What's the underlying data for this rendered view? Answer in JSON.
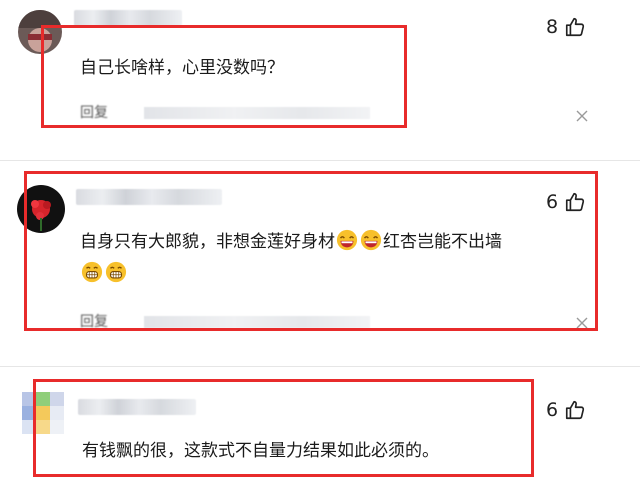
{
  "comments": [
    {
      "text": "自己长啥样，心里没数吗？",
      "likes": "8",
      "reply_label": "回复"
    },
    {
      "text_line1": "自身只有大郎貌，非想金莲好身材",
      "text_line1_tail": "红杏岂能不出墙",
      "likes": "6",
      "reply_label": "回复",
      "emoji": [
        "laughing-tears-emoji",
        "laughing-tears-emoji",
        "grinning-emoji",
        "grinning-emoji"
      ]
    },
    {
      "text": "有钱飘的很，这款式不自量力结果如此必须的。",
      "likes": "6"
    }
  ],
  "colors": {
    "highlight": "#e82b2b",
    "text": "#1a1a1a",
    "emoji_yellow": "#f7c02b"
  }
}
